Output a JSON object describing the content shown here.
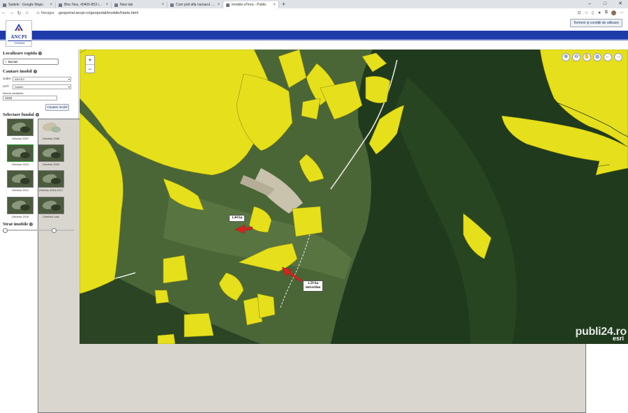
{
  "browser": {
    "tabs": [
      {
        "title": "Sadele - Google Maps",
        "active": false
      },
      {
        "title": "Bloc Nou, 40406-853 in cadastral",
        "active": false
      },
      {
        "title": "New tab",
        "active": false
      },
      {
        "title": "Cum poti afla numarul cadastral",
        "active": false
      },
      {
        "title": "Imobile eTerra - Public",
        "active": true
      }
    ],
    "security_label": "Nesigur",
    "url": "geoportal.ancpi.ro/geoportal/imobile/Harta.html"
  },
  "header": {
    "logo_name": "ANCPI",
    "logo_sub": "ROMANIA",
    "terms_button": "Termeni și condiții de utilizare"
  },
  "sidebar": {
    "quick_search": {
      "title": "Localizare rapida",
      "value": "Bucias"
    },
    "property_search": {
      "title": "Cautare imobil",
      "county_label": "Judet",
      "county_value": "ARGES",
      "uat_label": "UAT",
      "uat_value": "Sadele",
      "number_label": "Numar cadastral",
      "number_value": "3168",
      "button": "Cautare imobil"
    },
    "background": {
      "title": "Selectare fundal",
      "thumbs": [
        {
          "caption": "Ortofoto 2007"
        },
        {
          "caption": "Ortofoto 2008"
        },
        {
          "caption": "Ortofoto 2010"
        },
        {
          "caption": "Ortofoto 2009"
        },
        {
          "caption": "Ortofoto 2012"
        },
        {
          "caption": "Ortofoto 2015-2017"
        },
        {
          "caption": "Ortofoto 2018"
        },
        {
          "caption": "Ortofoto Last"
        }
      ]
    },
    "layers": {
      "title": "Strat imobile",
      "opacity": 0.7
    }
  },
  "map": {
    "zoom_in": "+",
    "zoom_out": "−",
    "labels": [
      {
        "text": "1,44 ha"
      },
      {
        "line1": "1,59 ha",
        "line2": "intravilan"
      }
    ],
    "attribution": "esri",
    "watermark": "publi24.ro",
    "colors": {
      "parcel": "#e6e01c",
      "forest": "#1f3a1c",
      "meadow": "#4d6a3a"
    }
  }
}
